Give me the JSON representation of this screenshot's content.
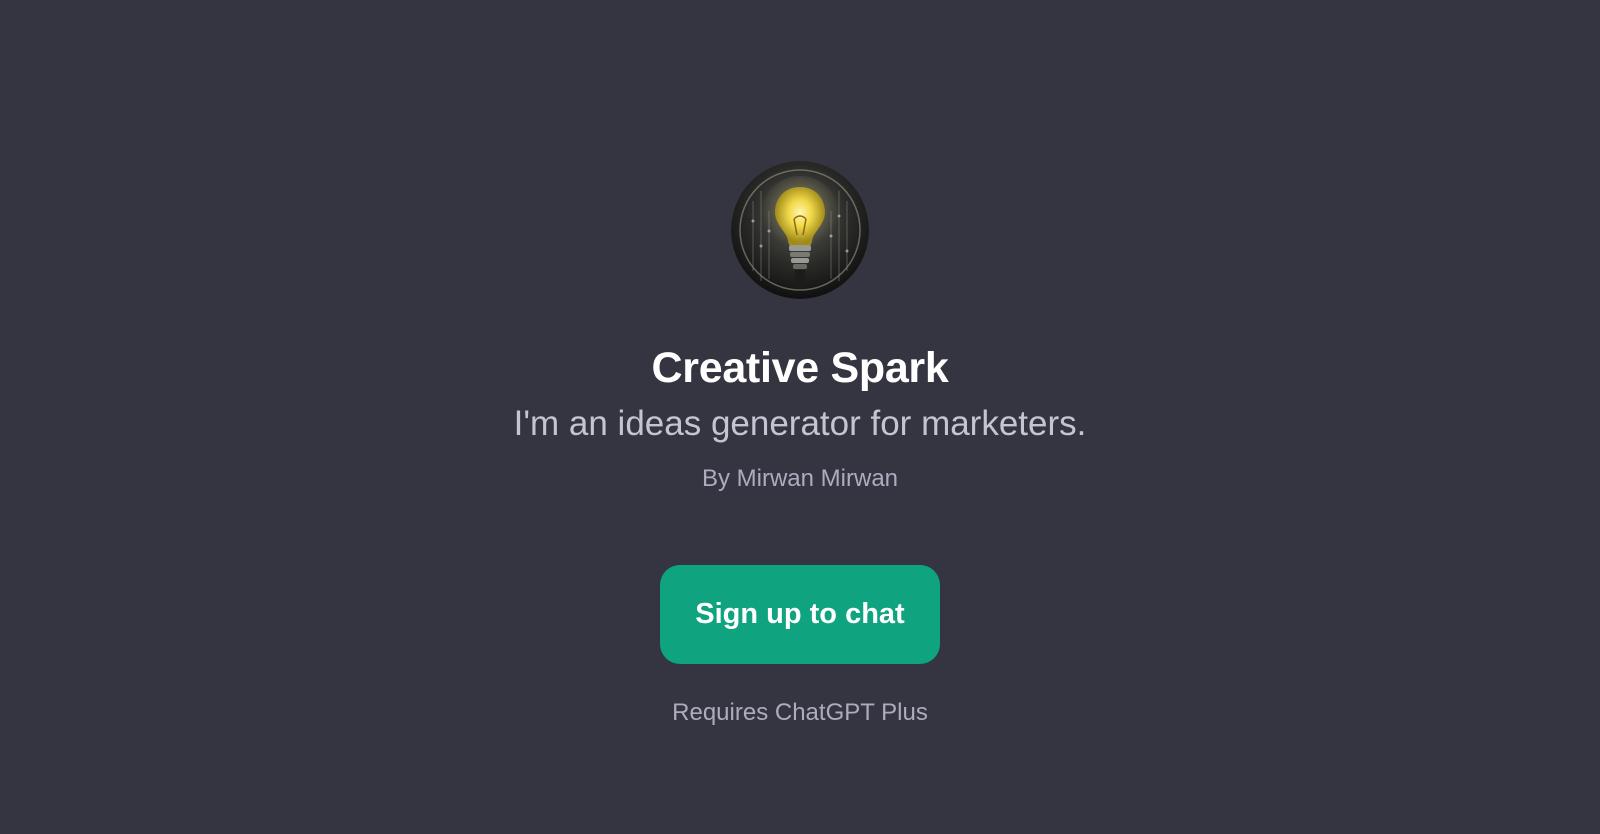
{
  "gpt": {
    "name": "Creative Spark",
    "description": "I'm an ideas generator for marketers.",
    "author": "By Mirwan Mirwan",
    "avatar_icon": "lightbulb-icon"
  },
  "actions": {
    "signup_label": "Sign up to chat"
  },
  "footer": {
    "requirement": "Requires ChatGPT Plus"
  },
  "colors": {
    "background": "#343541",
    "accent": "#10a37f",
    "title": "#ffffff",
    "subtitle": "#c5c5d2",
    "muted": "#acacbe"
  }
}
